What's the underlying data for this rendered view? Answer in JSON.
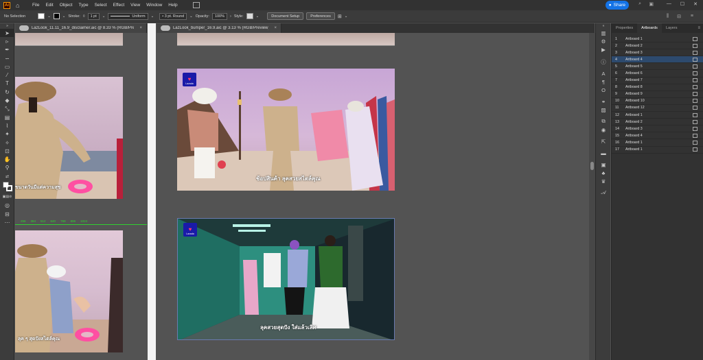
{
  "menubar": {
    "logo": "Ai",
    "items": [
      "File",
      "Edit",
      "Object",
      "Type",
      "Select",
      "Effect",
      "View",
      "Window",
      "Help"
    ],
    "share_label": "Share"
  },
  "controlbar": {
    "selection": "No Selection",
    "stroke_label": "Stroke:",
    "stroke_value": "1 pt",
    "uniform": "Uniform",
    "brush": "3 pt. Round",
    "opacity_label": "Opacity:",
    "opacity_value": "100%",
    "style_label": "Style:",
    "document_setup": "Document Setup",
    "preferences": "Preferences"
  },
  "tabs": [
    {
      "title": "LazLook_11.11_16.9_disclaimer.aic @ 8.33 % (RGB/Preview)"
    },
    {
      "title": "LazLook_bumper_16.9.aic @ 3.13 % (RGB/Preview)"
    }
  ],
  "ruler_ticks": [
    "256",
    "384",
    "512",
    "640",
    "768",
    "896",
    "1024"
  ],
  "scenes": {
    "brand": "Lazada",
    "beach_caption": "ช้อปสินค้า ลุคสวยสไตล์คุณ",
    "studio_caption": "ลุคสวยสุดปัง ใส่แล้วเลิศ"
  },
  "left_doc_captions": [
    "ขนาดวันมีแต่ความสุข",
    "ลุค ๆ สุดปังสไตล์คุณ"
  ],
  "panel": {
    "tabs": [
      "Properties",
      "Artboards",
      "Layers"
    ],
    "active_tab": "Artboards",
    "artboards": [
      {
        "num": "1",
        "name": "Artboard 1"
      },
      {
        "num": "2",
        "name": "Artboard 2"
      },
      {
        "num": "3",
        "name": "Artboard 3"
      },
      {
        "num": "4",
        "name": "Artboard 4"
      },
      {
        "num": "5",
        "name": "Artboard 5"
      },
      {
        "num": "6",
        "name": "Artboard 6"
      },
      {
        "num": "7",
        "name": "Artboard 7"
      },
      {
        "num": "8",
        "name": "Artboard 8"
      },
      {
        "num": "9",
        "name": "Artboard 9"
      },
      {
        "num": "10",
        "name": "Artboard 10"
      },
      {
        "num": "11",
        "name": "Artboard 12"
      },
      {
        "num": "12",
        "name": "Artboard 1"
      },
      {
        "num": "13",
        "name": "Artboard 2"
      },
      {
        "num": "14",
        "name": "Artboard 3"
      },
      {
        "num": "15",
        "name": "Artboard 4"
      },
      {
        "num": "16",
        "name": "Artboard 1"
      },
      {
        "num": "17",
        "name": "Artboard 1"
      }
    ],
    "selected_index": 3
  },
  "colors": {
    "accent": "#1473e6",
    "selection_row": "#2d4a6e",
    "ruler_green": "#2fd12f"
  }
}
